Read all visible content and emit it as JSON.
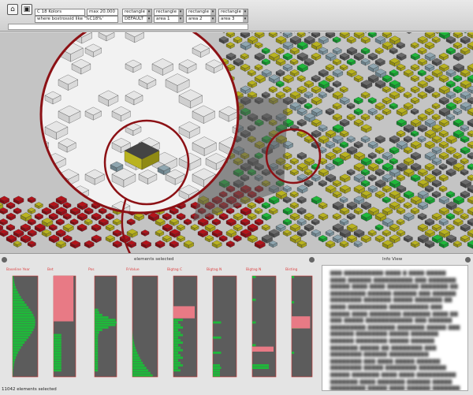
{
  "toolbar": {
    "query_field": "C 18 Kolors",
    "query_condition": "where bostrossid like '%C18%'",
    "limit_field": "max 20.000",
    "dropdowns": [
      {
        "layout": "rectangle",
        "value": "DEFAULT"
      },
      {
        "layout": "rectangle",
        "value": "area 1"
      },
      {
        "layout": "rectangle",
        "value": "area 2"
      },
      {
        "layout": "rectangle",
        "value": "area 3"
      }
    ]
  },
  "bottom": {
    "panel_header": "elements selected",
    "info_header": "Info View",
    "status": "11042 elements selected",
    "charts": [
      {
        "title": "Baseline Year"
      },
      {
        "title": "Bet"
      },
      {
        "title": "Pos"
      },
      {
        "title": "R-Value"
      },
      {
        "title": "Bigtag C"
      },
      {
        "title": "Bigtag N"
      },
      {
        "title": "Bigtag N"
      },
      {
        "title": "Bisting"
      }
    ]
  },
  "colors": {
    "green": "#1fb83a",
    "pink": "#e87a85",
    "chart_bg": "#5c5c5c",
    "olive": "#b9b320",
    "red": "#b3131a"
  },
  "icons": [
    "home-icon",
    "settings-icon"
  ]
}
